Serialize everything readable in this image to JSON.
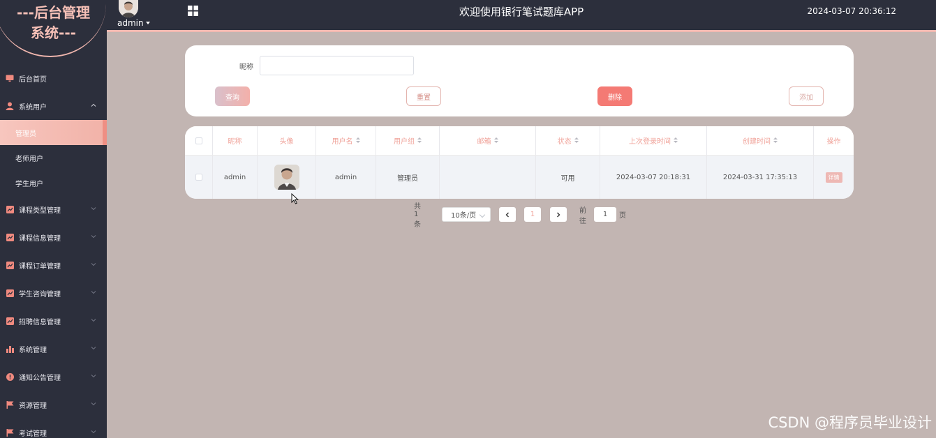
{
  "sidebar": {
    "logo_line1": "---后台管理",
    "logo_line2": "系统---",
    "items": [
      {
        "label": "后台首页",
        "icon": "monitor-icon"
      },
      {
        "label": "系统用户",
        "icon": "user-icon",
        "expanded": true,
        "children": [
          {
            "label": "管理员",
            "active": true
          },
          {
            "label": "老师用户"
          },
          {
            "label": "学生用户"
          }
        ]
      },
      {
        "label": "课程类型管理",
        "icon": "chart-icon"
      },
      {
        "label": "课程信息管理",
        "icon": "chart-icon"
      },
      {
        "label": "课程订单管理",
        "icon": "chart-icon"
      },
      {
        "label": "学生咨询管理",
        "icon": "chart-icon"
      },
      {
        "label": "招聘信息管理",
        "icon": "chart-icon"
      },
      {
        "label": "系统管理",
        "icon": "bar-chart-icon"
      },
      {
        "label": "通知公告管理",
        "icon": "info-icon"
      },
      {
        "label": "资源管理",
        "icon": "flag-icon"
      },
      {
        "label": "考试管理",
        "icon": "flag-icon"
      }
    ]
  },
  "header": {
    "username": "admin",
    "title": "欢迎使用银行笔试题库APP",
    "datetime": "2024-03-07 20:36:12"
  },
  "search": {
    "nickname_label": "昵称",
    "nickname_value": "",
    "query_label": "查询",
    "reset_label": "重置",
    "delete_label": "删除",
    "add_label": "添加"
  },
  "table": {
    "columns": [
      "昵称",
      "头像",
      "用户名",
      "用户组",
      "邮箱",
      "状态",
      "上次登录时间",
      "创建时间",
      "操作"
    ],
    "rows": [
      {
        "nickname": "admin",
        "username": "admin",
        "group": "管理员",
        "email": "",
        "status": "可用",
        "last_login": "2024-03-07 20:18:31",
        "created": "2024-03-31 17:35:13",
        "action": "详情"
      }
    ]
  },
  "pagination": {
    "total": "共 1 条",
    "page_size": "10条/页",
    "current": "1",
    "goto_label": "前往",
    "goto_value": "1",
    "page_suffix": "页"
  },
  "watermark": "CSDN @程序员毕业设计",
  "colors": {
    "sidebar_bg": "#2c2f3c",
    "accent": "#f0a39a",
    "content_bg": "#c2b5b2",
    "delete": "#f47a74"
  }
}
